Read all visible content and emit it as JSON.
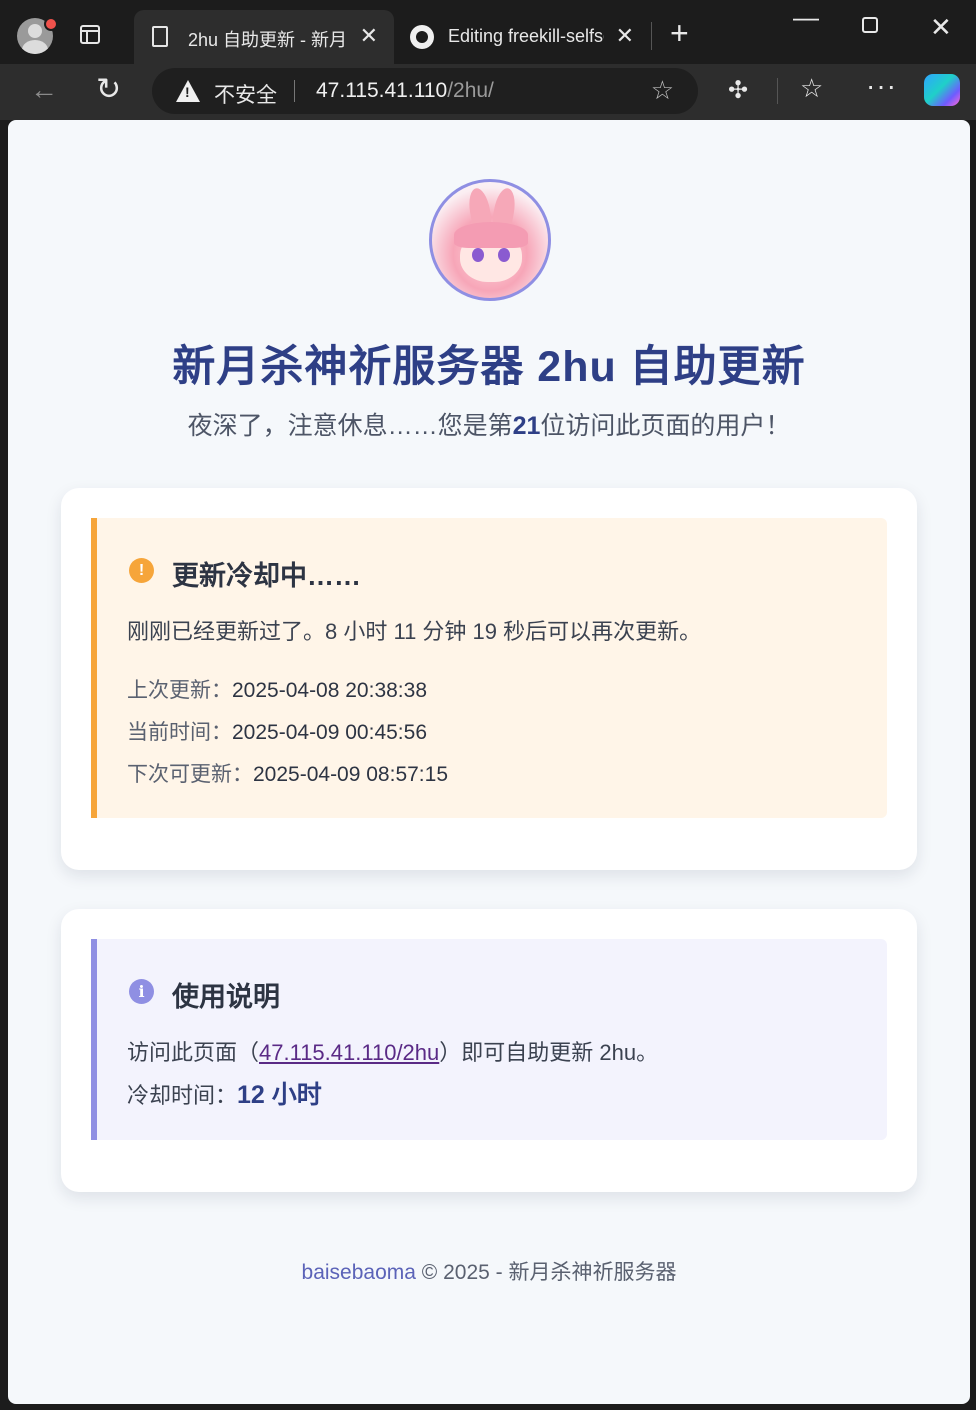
{
  "browser": {
    "tabs": [
      {
        "label": "2hu 自助更新 - 新月",
        "active": true
      },
      {
        "label": "Editing freekill-selfse",
        "active": false
      }
    ],
    "security_label": "不安全",
    "url_host": "47.115.41.110",
    "url_path": "/2hu/"
  },
  "page": {
    "title": "新月杀神祈服务器 2hu 自助更新",
    "greeting_prefix": "夜深了，注意休息……您是第",
    "visitor_number": "21",
    "greeting_suffix": "位访问此页面的用户！",
    "cooldown": {
      "title": "更新冷却中……",
      "message": "刚刚已经更新过了。8 小时 11 分钟 19 秒后可以再次更新。",
      "last_update_label": "上次更新：",
      "last_update_value": "2025-04-08 20:38:38",
      "current_time_label": "当前时间：",
      "current_time_value": "2025-04-09 00:45:56",
      "next_update_label": "下次可更新：",
      "next_update_value": "2025-04-09 08:57:15"
    },
    "instructions": {
      "title": "使用说明",
      "text_prefix": "访问此页面（",
      "link_text": "47.115.41.110/2hu",
      "text_suffix": "）即可自助更新 2hu。",
      "cooldown_label": "冷却时间：",
      "cooldown_value": "12 小时"
    },
    "footer": {
      "author": "baisebaoma",
      "rest": " © 2025 - 新月杀神祈服务器"
    }
  },
  "colors": {
    "title": "#2e3f86",
    "warn_accent": "#f6a53a",
    "info_accent": "#8f8fe3",
    "page_bg": "#f5f8fb"
  }
}
